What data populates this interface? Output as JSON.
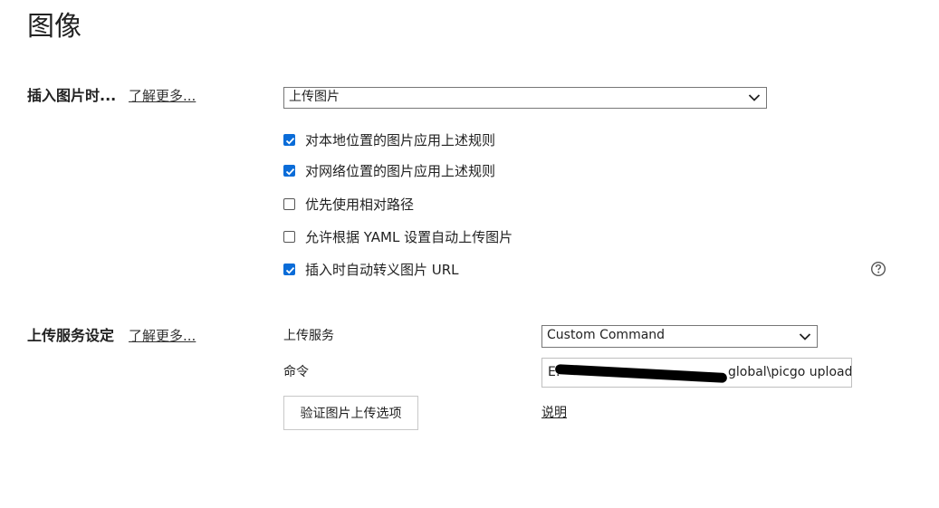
{
  "page": {
    "title": "图像"
  },
  "insert_section": {
    "label": "插入图片时...",
    "learn_more": "了解更多...",
    "select_value": "上传图片",
    "options": [
      {
        "label": "对本地位置的图片应用上述规则",
        "checked": true
      },
      {
        "label": "对网络位置的图片应用上述规则",
        "checked": true
      },
      {
        "label": "优先使用相对路径",
        "checked": false
      },
      {
        "label": "允许根据 YAML 设置自动上传图片",
        "checked": false
      },
      {
        "label": "插入时自动转义图片 URL",
        "checked": true
      }
    ],
    "help_icon": "question-circle-icon"
  },
  "upload_section": {
    "label": "上传服务设定",
    "learn_more": "了解更多...",
    "service_label": "上传服务",
    "service_value": "Custom Command",
    "command_label": "命令",
    "command_value": "E:\\                       npm_global\\picgo upload",
    "command_prefix": "E:",
    "command_suffix": "global\\picgo upload",
    "verify_button": "验证图片上传选项",
    "help_link": "说明"
  },
  "colors": {
    "accent": "#0a6cd8",
    "text": "#222222",
    "border": "#767676"
  }
}
